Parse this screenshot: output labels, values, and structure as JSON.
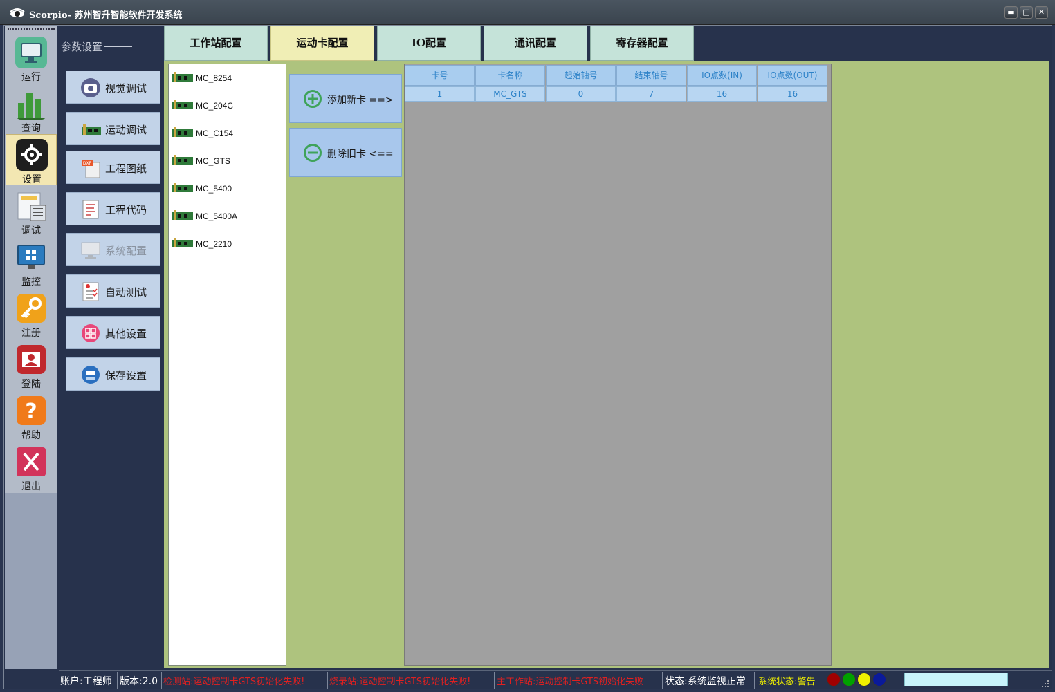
{
  "window": {
    "title": "Scorpio- 苏州智升智能软件开发系统",
    "min_label": "▬",
    "max_label": "□",
    "close_label": "✕"
  },
  "leftnav": {
    "items": [
      {
        "label": "运行",
        "icon": "monitor-icon",
        "color": "#4caf8a",
        "active": false
      },
      {
        "label": "查询",
        "icon": "bar-chart-icon",
        "color": "#3f9a3a",
        "active": false
      },
      {
        "label": "设置",
        "icon": "gear-icon",
        "color": "#222222",
        "active": true
      },
      {
        "label": "调试",
        "icon": "calculator-icon",
        "color": "#d0d6de",
        "active": false
      },
      {
        "label": "监控",
        "icon": "windows-monitor-icon",
        "color": "#2a7bbf",
        "active": false
      },
      {
        "label": "注册",
        "icon": "key-icon",
        "color": "#f0a21a",
        "active": false
      },
      {
        "label": "登陆",
        "icon": "user-card-icon",
        "color": "#c0282d",
        "active": false
      },
      {
        "label": "帮助",
        "icon": "question-icon",
        "color": "#f07a1a",
        "active": false
      },
      {
        "label": "退出",
        "icon": "exit-icon",
        "color": "#d2335a",
        "active": false
      }
    ]
  },
  "sidepanel": {
    "header": "参数设置",
    "buttons": [
      {
        "label": "视觉调试",
        "icon": "camera-icon",
        "enabled": true
      },
      {
        "label": "运动调试",
        "icon": "motion-card-icon",
        "enabled": true
      },
      {
        "label": "工程图纸",
        "icon": "dxf-file-icon",
        "enabled": true
      },
      {
        "label": "工程代码",
        "icon": "code-doc-icon",
        "enabled": true
      },
      {
        "label": "系统配置",
        "icon": "computer-icon",
        "enabled": false
      },
      {
        "label": "自动测试",
        "icon": "checklist-icon",
        "enabled": true
      },
      {
        "label": "其他设置",
        "icon": "grid-settings-icon",
        "enabled": true
      },
      {
        "label": "保存设置",
        "icon": "save-disk-icon",
        "enabled": true
      }
    ]
  },
  "tabs": [
    {
      "label": "工作站配置",
      "active": false
    },
    {
      "label": "运动卡配置",
      "active": true
    },
    {
      "label": "IO配置",
      "active": false
    },
    {
      "label": "通讯配置",
      "active": false
    },
    {
      "label": "寄存器配置",
      "active": false
    }
  ],
  "cardlist": {
    "items": [
      "MC_8254",
      "MC_204C",
      "MC_C154",
      "MC_GTS",
      "MC_5400",
      "MC_5400A",
      "MC_2210"
    ]
  },
  "actions": {
    "add_label": "添加新卡 ==>",
    "remove_label": "删除旧卡 <=="
  },
  "table": {
    "headers": [
      "卡号",
      "卡名称",
      "起始轴号",
      "结束轴号",
      "IO点数(IN)",
      "IO点数(OUT)"
    ],
    "rows": [
      [
        "1",
        "MC_GTS",
        "0",
        "7",
        "16",
        "16"
      ]
    ]
  },
  "status": {
    "account": "账户:工程师",
    "version": "版本:2.0",
    "msg1": "检测站:运动控制卡GTS初始化失败!",
    "msg2": "烧录站:运动控制卡GTS初始化失败!",
    "msg3": "主工作站:运动控制卡GTS初始化失败",
    "monitor": "状态:系统监视正常",
    "system": "系统状态:警告",
    "lamp_colors": [
      "#a00000",
      "#00a000",
      "#f0f000",
      "#0a1a9a"
    ],
    "error_color": "#e02020",
    "warn_color": "#f0f000"
  }
}
